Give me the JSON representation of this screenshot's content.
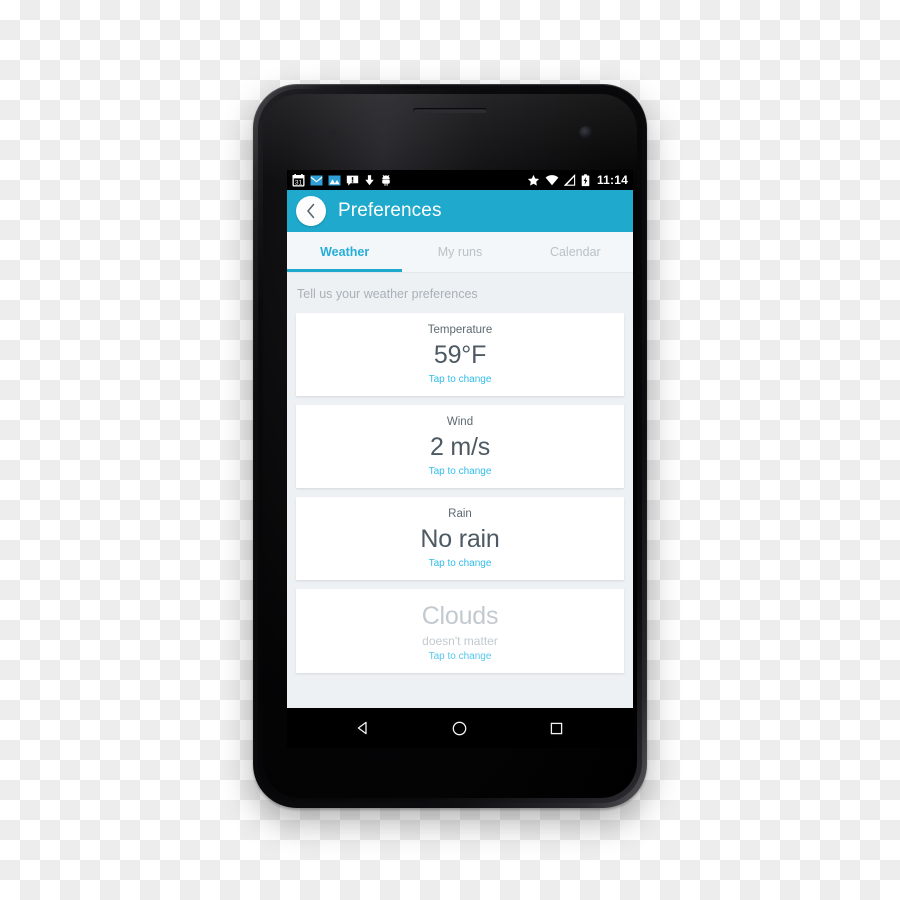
{
  "device": {
    "type": "android-smartphone",
    "earpiece": "earpiece-speaker",
    "front_camera": "front-camera"
  },
  "status_bar": {
    "time": "11:14",
    "left_icons": [
      {
        "name": "calendar-icon",
        "glyph": "31"
      },
      {
        "name": "email-icon",
        "glyph": ""
      },
      {
        "name": "gallery-icon",
        "glyph": ""
      },
      {
        "name": "message-alert-icon",
        "glyph": "!"
      },
      {
        "name": "download-icon",
        "glyph": "↓"
      },
      {
        "name": "android-debug-icon",
        "glyph": ""
      }
    ],
    "right_icons": [
      {
        "name": "star-icon",
        "glyph": "★"
      },
      {
        "name": "wifi-icon",
        "glyph": ""
      },
      {
        "name": "signal-no-service-icon",
        "glyph": ""
      },
      {
        "name": "battery-charging-icon",
        "glyph": ""
      }
    ]
  },
  "action_bar": {
    "title": "Preferences",
    "back_icon": "back-chevron-icon",
    "background_color": "#1fa9cc"
  },
  "tabs": {
    "active_index": 0,
    "items": [
      {
        "label": "Weather",
        "active": true
      },
      {
        "label": "My runs",
        "active": false
      },
      {
        "label": "Calendar",
        "active": false
      }
    ],
    "active_color": "#26aeda",
    "inactive_color": "#b9c2c8",
    "indicator_color": "#1fa9cc"
  },
  "content": {
    "section_title": "Tell us your weather preferences",
    "background_color": "#eef1f4",
    "cards": [
      {
        "name": "temperature",
        "label": "Temperature",
        "value": "59°F",
        "sub": "",
        "action": "Tap to change",
        "disabled": false
      },
      {
        "name": "wind",
        "label": "Wind",
        "value": "2 m/s",
        "sub": "",
        "action": "Tap to change",
        "disabled": false
      },
      {
        "name": "rain",
        "label": "Rain",
        "value": "No rain",
        "sub": "",
        "action": "Tap to change",
        "disabled": false
      },
      {
        "name": "clouds",
        "label": "",
        "value": "Clouds",
        "sub": "doesn't matter",
        "action": "Tap to change",
        "disabled": true
      }
    ]
  },
  "nav_bar": {
    "buttons": [
      {
        "name": "back-button",
        "icon": "triangle-left-icon"
      },
      {
        "name": "home-button",
        "icon": "circle-icon"
      },
      {
        "name": "recents-button",
        "icon": "square-icon"
      }
    ]
  }
}
